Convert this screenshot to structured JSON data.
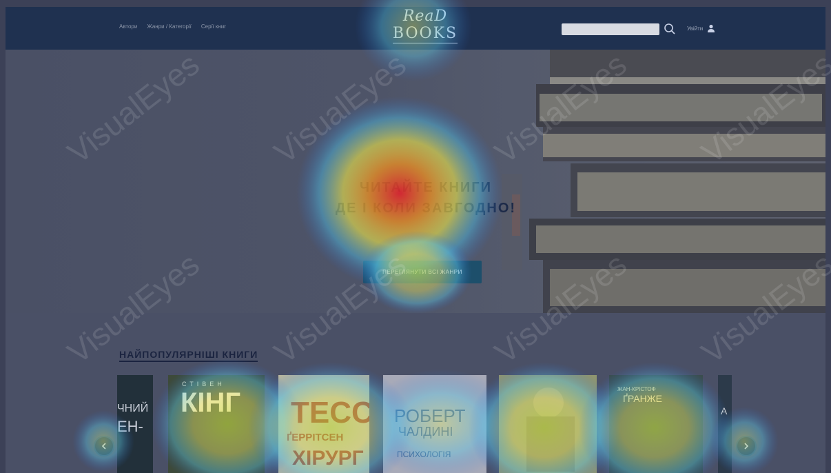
{
  "header": {
    "nav": [
      {
        "label": "Автори"
      },
      {
        "label": "Жанри / Категорії"
      },
      {
        "label": "Серії книг"
      }
    ],
    "logo_line1": "ReaD",
    "logo_line2": "BOOKS",
    "search_placeholder": "",
    "login_label": "Увійти"
  },
  "hero": {
    "title_line1": "ЧИТАЙТЕ КНИГИ",
    "title_line2": "ДЕ І КОЛИ ЗАВГОДНО!",
    "cta_label": "ПЕРЕГЛЯНУТИ ВСІ ЖАНРИ"
  },
  "popular": {
    "title": "НАЙПОПУЛЯРНІШІ КНИГИ",
    "books": [
      {
        "text1": "ЧНИЙ",
        "text2": "ЕН-"
      },
      {
        "text1": "СТІВЕН",
        "text2": "КІНГ"
      },
      {
        "text1": "ТЕСС",
        "text2": "ҐЕРРІТСЕН",
        "text3": "ХІРУРГ"
      },
      {
        "text1": "РОБЕРТ",
        "text2": "ЧАЛДИНІ",
        "text3": "ПСИХОЛОГІЯ"
      },
      {
        "text1": ""
      },
      {
        "text1": "ЖАН-КРІСТОФ",
        "text2": "ҐРАНЖЕ"
      },
      {
        "text1": "А"
      }
    ]
  },
  "watermark": "VisualEyes",
  "colors": {
    "header_bg": "#1f3150",
    "cta_bg": "#1d4f6b",
    "nav_text": "#8b95a8"
  }
}
